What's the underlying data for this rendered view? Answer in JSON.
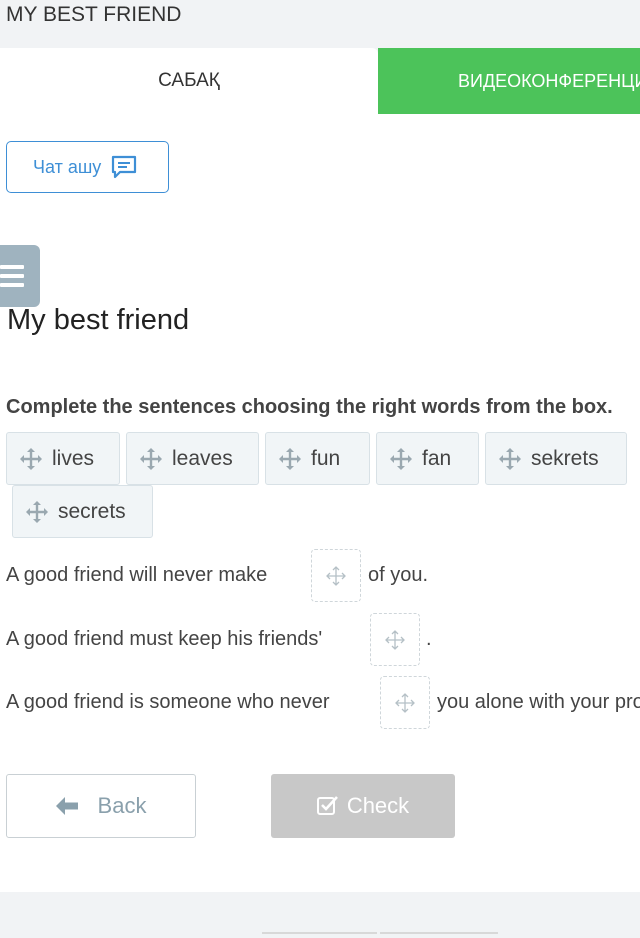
{
  "header": {
    "title": "MY BEST FRIEND"
  },
  "tabs": [
    {
      "label": "САБАҚ"
    },
    {
      "label": "ВИДЕОКОНФЕРЕНЦИЯ"
    }
  ],
  "chat_button": {
    "label": "Чат ашу",
    "icon": "chat-icon"
  },
  "menu_button": {
    "icon": "hamburger-icon"
  },
  "lesson": {
    "title": "My best friend",
    "instruction": "Complete the sentences choosing the right words from the box."
  },
  "word_bank": [
    {
      "label": "lives"
    },
    {
      "label": "leaves"
    },
    {
      "label": "fun"
    },
    {
      "label": "fan"
    },
    {
      "label": "sekrets"
    },
    {
      "label": "secrets"
    }
  ],
  "sentences": [
    {
      "before": "A good friend will never make",
      "after": "of you."
    },
    {
      "before": "A good friend must keep his friends'",
      "after": "."
    },
    {
      "before": "A good friend is someone who never",
      "after": "you alone with your problems."
    }
  ],
  "actions": {
    "back_label": "Back",
    "check_label": "Check"
  },
  "colors": {
    "accent": "#3e8fd6",
    "tab_green": "#4cc35a",
    "check_disabled": "#c8c8c8"
  }
}
